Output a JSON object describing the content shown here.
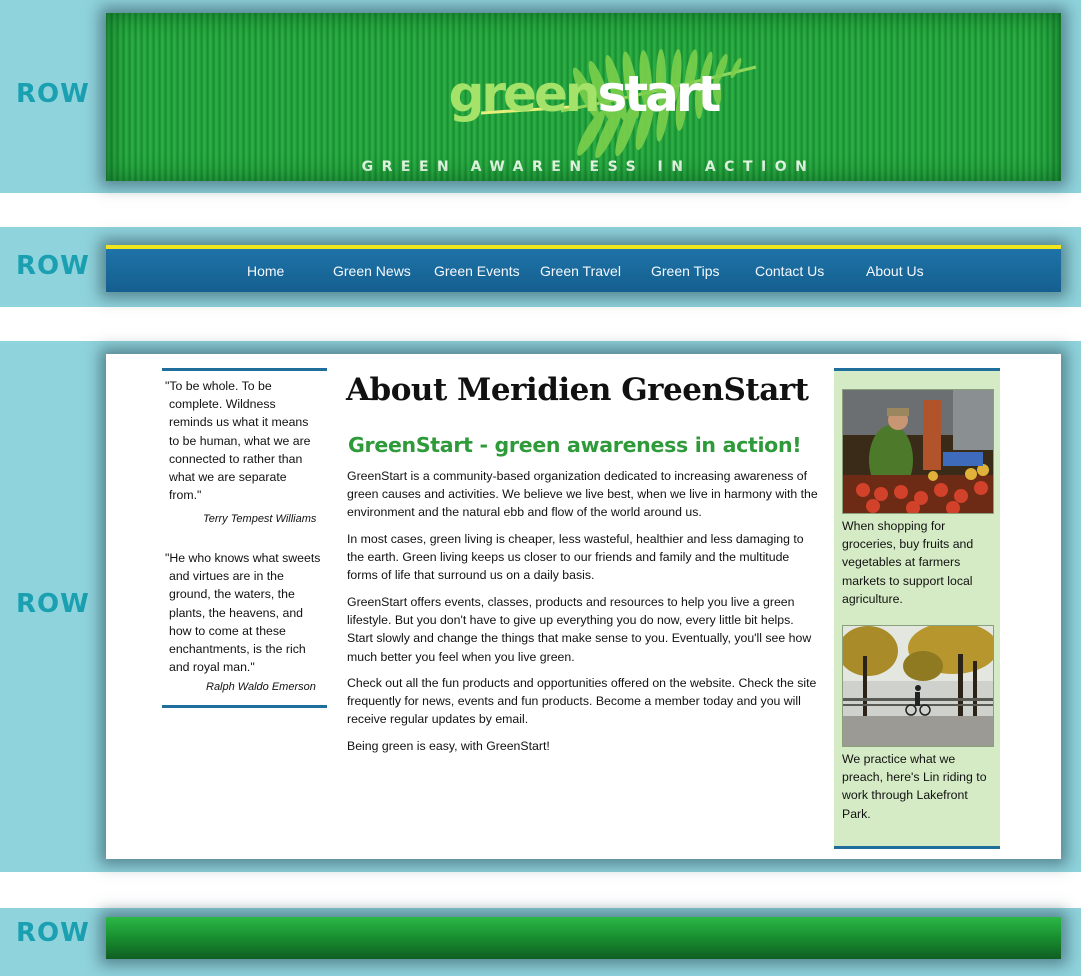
{
  "rows": {
    "label": "ROW"
  },
  "header": {
    "logo_part1": "green",
    "logo_part2": "start",
    "tagline": "GREEN AWARENESS IN ACTION"
  },
  "nav": {
    "items": [
      {
        "label": "Home"
      },
      {
        "label": "Green News"
      },
      {
        "label": "Green Events"
      },
      {
        "label": "Green Travel"
      },
      {
        "label": "Green Tips"
      },
      {
        "label": "Contact Us"
      },
      {
        "label": "About Us"
      }
    ]
  },
  "sidebar_left": {
    "quotes": [
      {
        "lines": [
          "\"To be whole. To be",
          "complete. Wildness",
          "reminds us what it means",
          "to be human, what we are",
          "connected to rather than",
          "what we are separate",
          "from.\""
        ],
        "author": "Terry Tempest Williams"
      },
      {
        "lines": [
          "\"He who knows what sweets",
          "and virtues are in the",
          "ground, the waters, the",
          "plants, the heavens, and",
          "how to come at these",
          "enchantments, is the rich",
          "and royal man.\""
        ],
        "author": "Ralph Waldo Emerson"
      }
    ]
  },
  "main": {
    "title": "About Meridien GreenStart",
    "subtitle": "GreenStart - green awareness in action!",
    "paragraphs": [
      [
        "GreenStart is a community-based organization dedicated to increasing awareness of",
        "green causes and activities. We believe we live best, when we live in harmony with the",
        "environment and the natural ebb and flow of the world around us."
      ],
      [
        "In most cases, green living is cheaper, less wasteful, healthier and less damaging to",
        "the earth. Green living keeps us closer to our friends and family and the multitude",
        "forms of life that surround us on a daily basis."
      ],
      [
        "GreenStart offers events, classes, products and resources to help you live a green",
        "lifestyle. But you don't have to give up everything you do now, every little bit helps.",
        "Start slowly and change the things that make sense to you. Eventually, you'll see how",
        "much better you feel when you live green."
      ],
      [
        "Check out all the fun products and opportunities offered on the website. Check the site",
        "frequently for news, events and fun products. Become a member today and you will",
        "receive regular updates by email."
      ],
      [
        "Being green is easy, with GreenStart!"
      ]
    ]
  },
  "sidebar_right": {
    "items": [
      {
        "caption_lines": [
          "When shopping for",
          "groceries, buy fruits and",
          "vegetables at farmers",
          "markets to support local",
          "agriculture."
        ]
      },
      {
        "caption_lines": [
          "We practice what we",
          "preach, here's Lin riding to",
          "work through Lakefront",
          "Park."
        ]
      }
    ]
  },
  "colors": {
    "band": "#8fd3dc",
    "row_label": "#1aa0b0",
    "nav_bar": "#1e73a8",
    "nav_accent": "#f1e51c",
    "subtitle_green": "#2e9a3a",
    "sidebar_border": "#1f6e9c",
    "sidebar_right_bg": "#d5ebc5"
  }
}
